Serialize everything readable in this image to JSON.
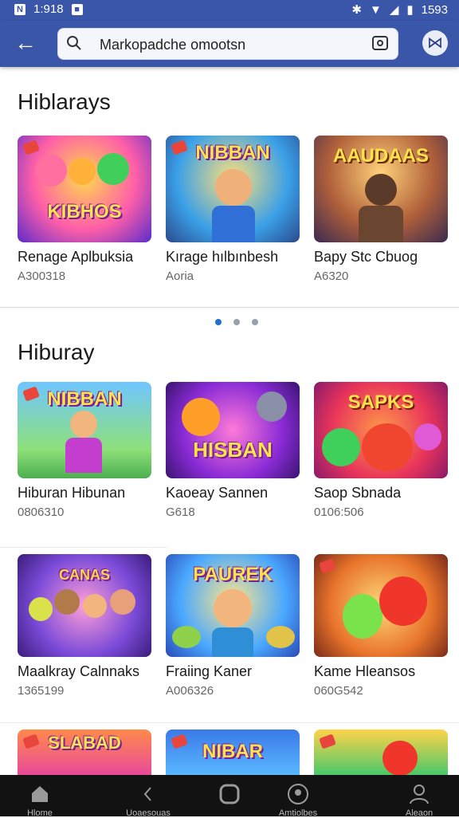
{
  "status_bar": {
    "left_time": "1:918",
    "right_time": "1593"
  },
  "search": {
    "value": "Markopadche omootsn"
  },
  "sections": [
    {
      "title": "Hiblarays",
      "items": [
        {
          "title": "Renage Aplbuksia",
          "sub": "A300318",
          "art": "KIBHOS"
        },
        {
          "title": "Kırage hılbınbesh",
          "sub": "Aoria",
          "art": "NIBBAN"
        },
        {
          "title": "Bapy Stc Cbuog",
          "sub": "A6320",
          "art": "AAUDAAS"
        }
      ]
    },
    {
      "title": "Hiburay",
      "items": [
        {
          "title": "Hiburan Hibunan",
          "sub": "0806310",
          "art": "NIBBAN"
        },
        {
          "title": "Kaoeay Sannen",
          "sub": "G618",
          "art": "HISBAN"
        },
        {
          "title": "Saop Sbnada",
          "sub": "0106:506",
          "art": "SAPKS"
        },
        {
          "title": "Maalkray Calnnaks",
          "sub": "1365199",
          "art": "CANAS"
        },
        {
          "title": "Fraiing Kaner",
          "sub": "A006326",
          "art": "PAUREK"
        },
        {
          "title": "Kame Hleansos",
          "sub": "060G542",
          "art": ""
        },
        {
          "title": "",
          "sub": "",
          "art": "SLABAD"
        },
        {
          "title": "",
          "sub": "",
          "art": "NIBAR"
        },
        {
          "title": "",
          "sub": "",
          "art": ""
        }
      ]
    }
  ],
  "pager": {
    "count": 3,
    "active": 0
  },
  "nav": [
    {
      "label": "Hlome",
      "icon": "home-icon"
    },
    {
      "label": "Uoaesouas",
      "icon": "back-arrow-icon"
    },
    {
      "label": "",
      "icon": "home-circle-icon"
    },
    {
      "label": "Amtiolbes",
      "icon": "profile-badge-icon"
    },
    {
      "label": "Aleaon",
      "icon": "person-icon"
    }
  ],
  "colors": {
    "accent": "#3a56a8",
    "active_dot": "#1f6fd1"
  }
}
